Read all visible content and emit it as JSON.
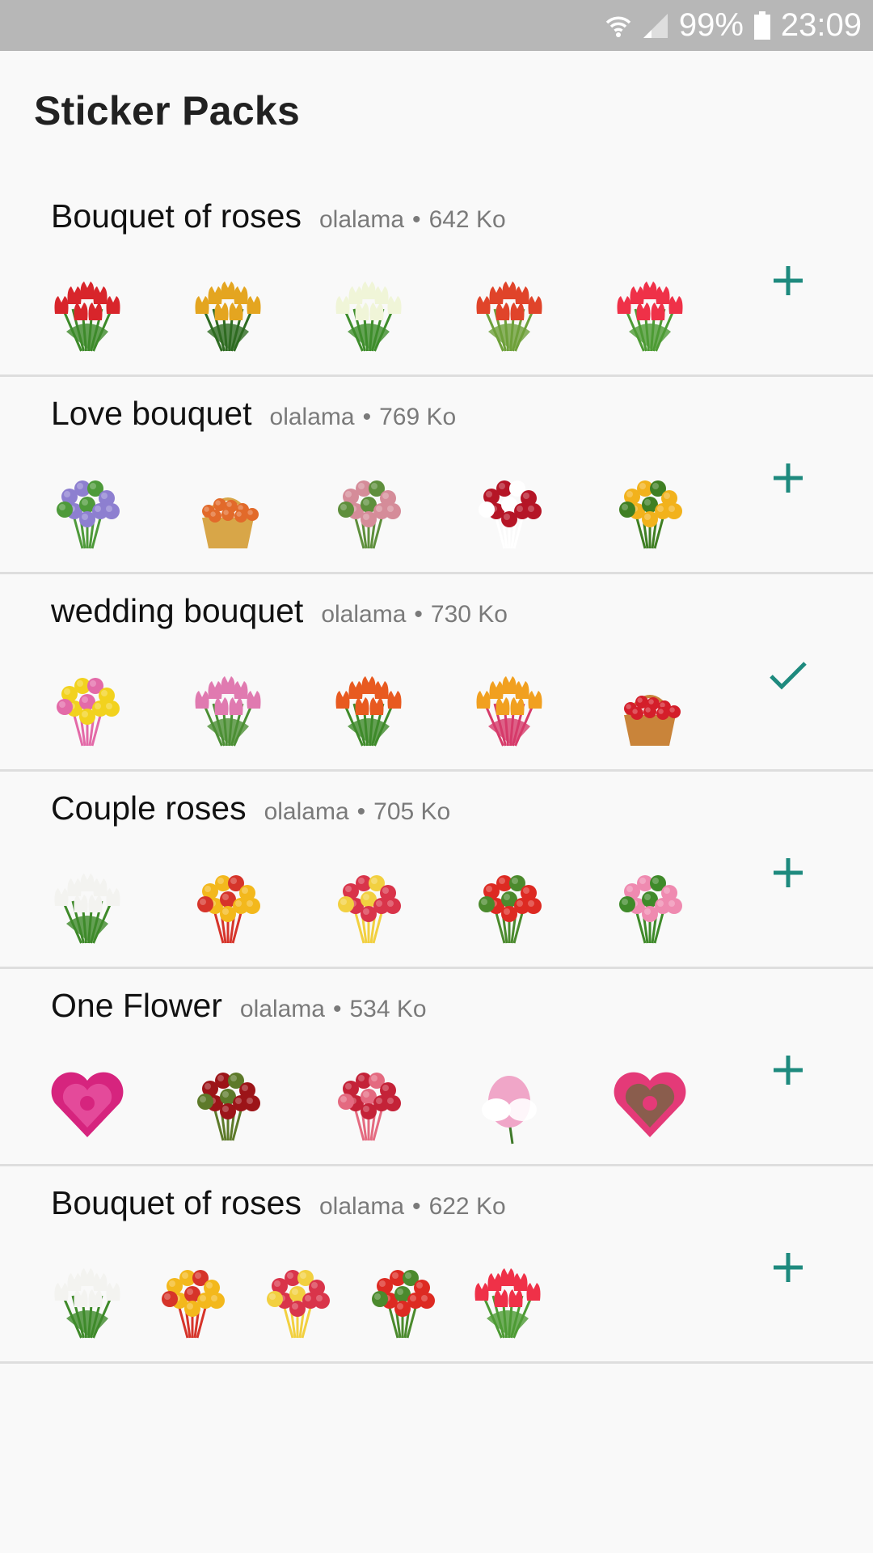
{
  "status_bar": {
    "battery": "99%",
    "time": "23:09",
    "icons": [
      "wifi-icon",
      "signal-icon",
      "battery-icon"
    ]
  },
  "title": "Sticker Packs",
  "accent_color": "#1e8a7e",
  "packs": [
    {
      "name": "Bouquet of roses",
      "publisher": "olalama",
      "size": "642 Ko",
      "action": "add",
      "stickers": [
        {
          "icon": "red-tulip-bouquet",
          "colors": [
            "#d8252b",
            "#3d8a2a"
          ]
        },
        {
          "icon": "yellow-tulip-bouquet",
          "colors": [
            "#e4a520",
            "#2e6b22"
          ]
        },
        {
          "icon": "white-tulip-bouquet",
          "colors": [
            "#f0f5d8",
            "#3f8d2c"
          ]
        },
        {
          "icon": "red-tulip-bundle",
          "colors": [
            "#e0442a",
            "#6ea03a"
          ]
        },
        {
          "icon": "pink-tulip-bunch",
          "colors": [
            "#ef3148",
            "#4d9b34"
          ]
        }
      ]
    },
    {
      "name": "Love bouquet",
      "publisher": "olalama",
      "size": "769 Ko",
      "action": "add",
      "stickers": [
        {
          "icon": "iris-lily-bouquet",
          "colors": [
            "#8d7fd0",
            "#4e9a3a"
          ]
        },
        {
          "icon": "flower-basket",
          "colors": [
            "#e26a2a",
            "#d8a648"
          ]
        },
        {
          "icon": "pink-rose-bouquet",
          "colors": [
            "#d58c99",
            "#5e8f3c"
          ]
        },
        {
          "icon": "red-white-rose-bouquet",
          "colors": [
            "#b51526",
            "#ffffff"
          ]
        },
        {
          "icon": "yellow-flower-bouquet",
          "colors": [
            "#f2b21c",
            "#3f7f23"
          ]
        }
      ]
    },
    {
      "name": "wedding bouquet",
      "publisher": "olalama",
      "size": "730 Ko",
      "action": "added",
      "stickers": [
        {
          "icon": "yellow-pink-rose-bouquet",
          "colors": [
            "#f2d21e",
            "#e36aa8"
          ]
        },
        {
          "icon": "pink-tulip-bouquet",
          "colors": [
            "#e07ab0",
            "#4c8f35"
          ]
        },
        {
          "icon": "orange-tulip-bouquet",
          "colors": [
            "#e85a20",
            "#3f8a2a"
          ]
        },
        {
          "icon": "mixed-tulip-vase",
          "colors": [
            "#f1a020",
            "#d63b6a"
          ]
        },
        {
          "icon": "red-rose-basket",
          "colors": [
            "#d41e2a",
            "#c9843a"
          ]
        }
      ]
    },
    {
      "name": "Couple roses",
      "publisher": "olalama",
      "size": "705 Ko",
      "action": "add",
      "stickers": [
        {
          "icon": "white-tulip-bunch",
          "colors": [
            "#f3f3f0",
            "#3f8a2a"
          ]
        },
        {
          "icon": "mixed-exotic-bouquet",
          "colors": [
            "#f3b81c",
            "#d6342a"
          ]
        },
        {
          "icon": "rose-cascade-bouquet",
          "colors": [
            "#d9344a",
            "#f2d040"
          ]
        },
        {
          "icon": "red-rose-bunch",
          "colors": [
            "#dd2a22",
            "#4b8a2d"
          ]
        },
        {
          "icon": "pink-rose-bouquet-round",
          "colors": [
            "#ef8ab0",
            "#3f8a2a"
          ]
        }
      ]
    },
    {
      "name": "One Flower",
      "publisher": "olalama",
      "size": "534 Ko",
      "action": "add",
      "stickers": [
        {
          "icon": "heart-rose",
          "colors": [
            "#d6247e",
            "#f06ab0"
          ]
        },
        {
          "icon": "dark-red-rose-bouquet",
          "colors": [
            "#9c1418",
            "#5d7a2a"
          ]
        },
        {
          "icon": "red-rose-dome",
          "colors": [
            "#c42238",
            "#e46a80"
          ]
        },
        {
          "icon": "pink-lotus",
          "colors": [
            "#f0a6c8",
            "#ffffff"
          ]
        },
        {
          "icon": "pink-heart-wreath",
          "colors": [
            "#e43a78",
            "#3f7a2a"
          ]
        }
      ]
    },
    {
      "name": "Bouquet of roses",
      "publisher": "olalama",
      "size": "622 Ko",
      "action": "add",
      "stickers": [
        {
          "icon": "white-tulip-bunch",
          "colors": [
            "#f3f3f0",
            "#3f8a2a"
          ]
        },
        {
          "icon": "mixed-exotic-bouquet",
          "colors": [
            "#f3b81c",
            "#d6342a"
          ]
        },
        {
          "icon": "rose-cascade-bouquet",
          "colors": [
            "#d9344a",
            "#f2d040"
          ]
        },
        {
          "icon": "red-rose-bunch",
          "colors": [
            "#dd2a22",
            "#4b8a2d"
          ]
        },
        {
          "icon": "pink-tulip-bunch",
          "colors": [
            "#ef3148",
            "#4d9b34"
          ]
        }
      ]
    }
  ]
}
